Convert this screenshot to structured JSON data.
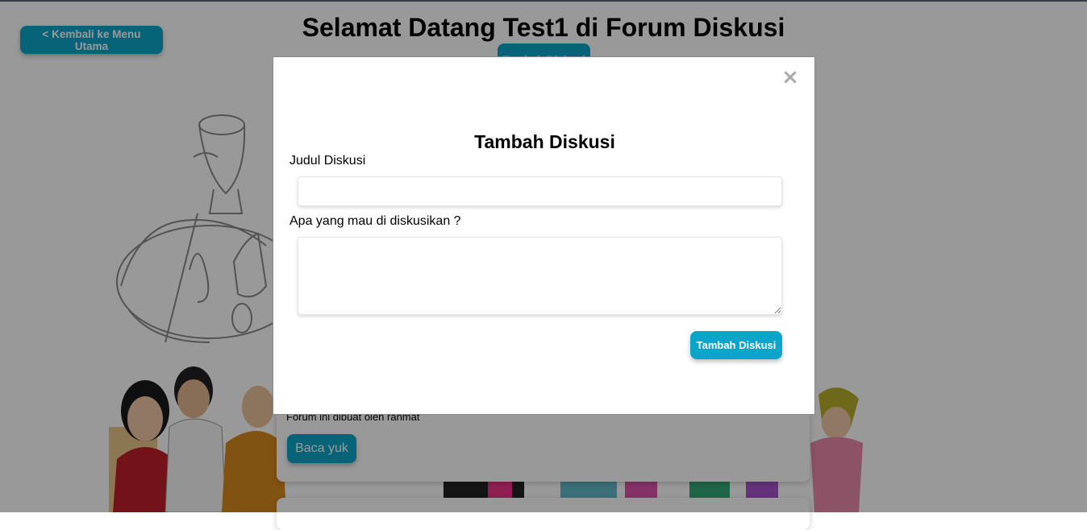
{
  "page": {
    "title": "Selamat Datang Test1 di Forum Diskusi",
    "back_label": "< Kembali ke Menu Utama",
    "add_label": "Tambah Diskusi"
  },
  "forum": {
    "author_text": "Forum ini dibuat oleh rahmat",
    "read_label": "Baca yuk"
  },
  "modal": {
    "title": "Tambah Diskusi",
    "close_symbol": "×",
    "title_label": "Judul Diskusi",
    "title_value": "",
    "desc_label": "Apa yang mau di diskusikan ?",
    "desc_value": "",
    "submit_label": "Tambah Diskusi"
  },
  "colors": {
    "accent": "#0aa5c9",
    "overlay": "rgba(0,0,0,0.4)"
  }
}
